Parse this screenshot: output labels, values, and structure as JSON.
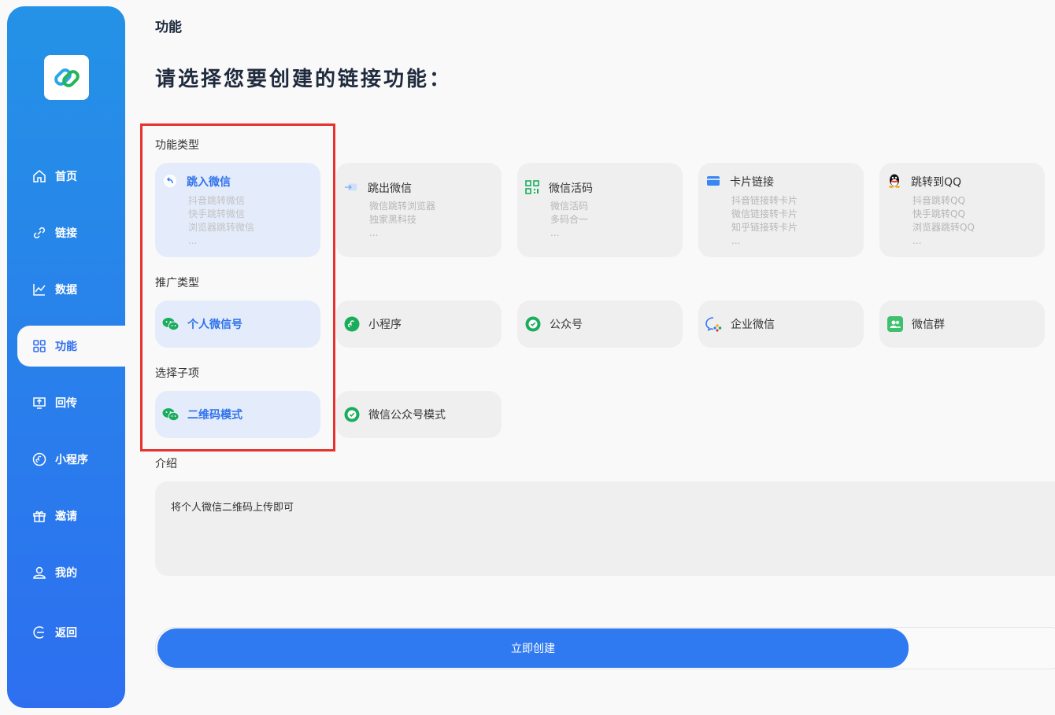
{
  "sidebar": {
    "items": [
      {
        "label": "首页",
        "icon": "home-icon"
      },
      {
        "label": "链接",
        "icon": "link-icon"
      },
      {
        "label": "数据",
        "icon": "chart-icon"
      },
      {
        "label": "功能",
        "icon": "grid-icon"
      },
      {
        "label": "回传",
        "icon": "upload-icon"
      },
      {
        "label": "小程序",
        "icon": "mini-program-icon"
      },
      {
        "label": "邀请",
        "icon": "gift-icon"
      },
      {
        "label": "我的",
        "icon": "user-icon"
      },
      {
        "label": "返回",
        "icon": "back-icon"
      }
    ],
    "active": "功能"
  },
  "header": {
    "title": "功能",
    "headline": "请选择您要创建的链接功能："
  },
  "sections": {
    "function_type": "功能类型",
    "promo_type": "推广类型",
    "sub_item": "选择子项",
    "intro": "介绍"
  },
  "function_cards": [
    {
      "title": "跳入微信",
      "subs": [
        "抖音跳转微信",
        "快手跳转微信",
        "浏览器跳转微信",
        "..."
      ],
      "icon": "reply-icon"
    },
    {
      "title": "跳出微信",
      "subs": [
        "微信跳转浏览器",
        "独家黑科技",
        "..."
      ],
      "icon": "external-link-icon"
    },
    {
      "title": "微信活码",
      "subs": [
        "微信活码",
        "多码合一",
        "..."
      ],
      "icon": "qrcode-icon"
    },
    {
      "title": "卡片链接",
      "subs": [
        "抖音链接转卡片",
        "微信链接转卡片",
        "知乎链接转卡片",
        "..."
      ],
      "icon": "card-icon"
    },
    {
      "title": "跳转到QQ",
      "subs": [
        "抖音跳转QQ",
        "快手跳转QQ",
        "浏览器跳转QQ",
        "..."
      ],
      "icon": "qq-icon"
    }
  ],
  "promo_types": [
    {
      "label": "个人微信号",
      "icon": "wechat-icon"
    },
    {
      "label": "小程序",
      "icon": "mini-program-icon"
    },
    {
      "label": "公众号",
      "icon": "official-account-icon"
    },
    {
      "label": "企业微信",
      "icon": "wecom-icon"
    },
    {
      "label": "微信群",
      "icon": "group-icon"
    }
  ],
  "sub_items": [
    {
      "label": "二维码模式",
      "icon": "wechat-icon"
    },
    {
      "label": "微信公众号模式",
      "icon": "official-account-icon"
    }
  ],
  "intro_text": "将个人微信二维码上传即可",
  "submit_label": "立即创建",
  "colors": {
    "accent": "#2f7af0",
    "sidebar_top": "#2492e6",
    "sidebar_bottom": "#2d6ff0",
    "highlight": "#e6312e",
    "selected_bg": "#e4ecfb"
  }
}
